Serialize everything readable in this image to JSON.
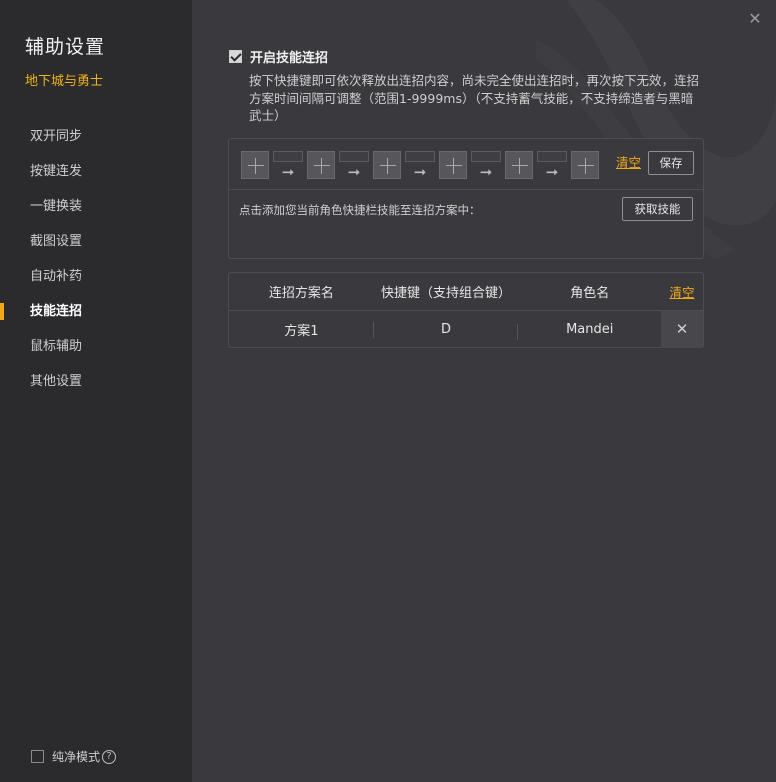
{
  "sidebar": {
    "title": "辅助设置",
    "game": "地下城与勇士",
    "items": [
      {
        "label": "双开同步"
      },
      {
        "label": "按键连发"
      },
      {
        "label": "一键换装"
      },
      {
        "label": "截图设置"
      },
      {
        "label": "自动补药"
      },
      {
        "label": "技能连招",
        "active": true
      },
      {
        "label": "鼠标辅助"
      },
      {
        "label": "其他设置"
      }
    ],
    "pure_mode_label": "纯净模式",
    "help_glyph": "?"
  },
  "main": {
    "close_glyph": "✕",
    "enable_label": "开启技能连招",
    "enable_checked": true,
    "description": "按下快捷键即可依次释放出连招内容，尚未完全使出连招时，再次按下无效，连招方案时间间隔可调整（范围1-9999ms）（不支持蓄气技能，不支持缔造者与黑暗武士）",
    "combo": {
      "slot_count": 6,
      "interval_values": [
        "",
        "",
        "",
        "",
        ""
      ],
      "arrow_glyph": "➞",
      "clear_label": "清空",
      "save_label": "保存",
      "hint": "点击添加您当前角色快捷栏技能至连招方案中：",
      "fetch_label": "获取技能"
    },
    "table": {
      "headers": [
        "连招方案名",
        "快捷键（支持组合键）",
        "角色名"
      ],
      "clear_label": "清空",
      "rows": [
        {
          "name": "方案1",
          "hotkey": "D",
          "role": "Mandei",
          "delete_glyph": "✕"
        }
      ]
    }
  },
  "colors": {
    "accent": "#f0a81c",
    "sidebar_bg": "#2b2b2e",
    "main_bg": "#3a3a3e"
  },
  "icons": {
    "close": "close-icon",
    "plus": "plus-icon",
    "arrow": "arrow-right-icon",
    "help": "help-icon",
    "delete": "close-icon"
  }
}
